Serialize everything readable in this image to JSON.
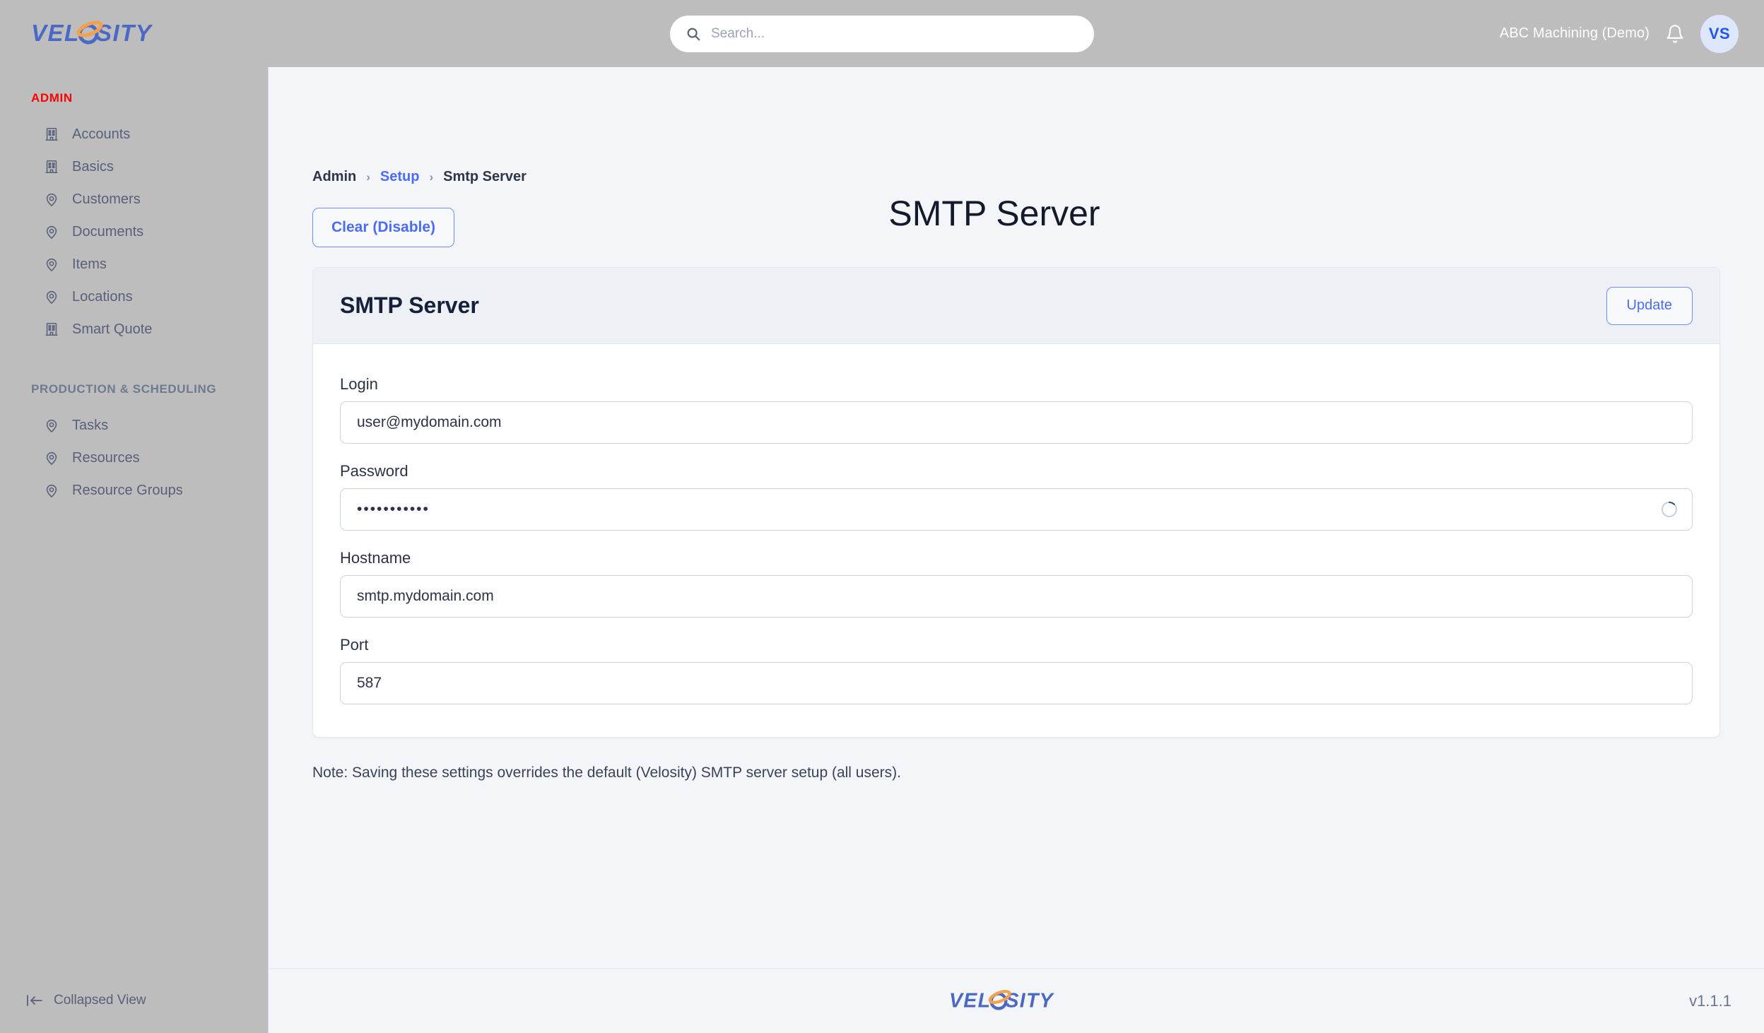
{
  "brand": {
    "name": "VELOSITY",
    "logo_icon": "velosity-logo"
  },
  "topbar": {
    "search": {
      "placeholder": "Search...",
      "value": "",
      "icon": "search-icon"
    },
    "org_name": "ABC Machining (Demo)",
    "notifications_icon": "bell-icon",
    "avatar_initials": "VS"
  },
  "sidebar": {
    "sections": [
      {
        "label": "ADMIN",
        "color": "#ff0000",
        "items": [
          {
            "label": "Accounts",
            "icon": "building-icon"
          },
          {
            "label": "Basics",
            "icon": "building-icon"
          },
          {
            "label": "Customers",
            "icon": "map-pin-icon"
          },
          {
            "label": "Documents",
            "icon": "map-pin-icon"
          },
          {
            "label": "Items",
            "icon": "map-pin-icon"
          },
          {
            "label": "Locations",
            "icon": "map-pin-icon"
          },
          {
            "label": "Smart Quote",
            "icon": "building-icon"
          }
        ]
      },
      {
        "label": "PRODUCTION & SCHEDULING",
        "color": "#707a8f",
        "items": [
          {
            "label": "Tasks",
            "icon": "map-pin-icon"
          },
          {
            "label": "Resources",
            "icon": "map-pin-icon"
          },
          {
            "label": "Resource Groups",
            "icon": "map-pin-icon"
          }
        ]
      }
    ],
    "collapse": {
      "label": "Collapsed View",
      "icon": "collapse-left-icon"
    }
  },
  "breadcrumb": {
    "items": [
      {
        "label": "Admin",
        "link": false
      },
      {
        "label": "Setup",
        "link": true
      },
      {
        "label": "Smtp Server",
        "link": false
      }
    ],
    "separator": "›"
  },
  "page": {
    "title": "SMTP Server",
    "clear_button": "Clear (Disable)",
    "note": "Note: Saving these settings overrides the default (Velosity) SMTP server setup (all users)."
  },
  "card": {
    "title": "SMTP Server",
    "update_button": "Update",
    "fields": [
      {
        "label": "Login",
        "value": "user@mydomain.com",
        "placeholder": "",
        "type": "text",
        "name": "login"
      },
      {
        "label": "Password",
        "value": "•••••••••••",
        "placeholder": "",
        "type": "password",
        "name": "password",
        "trailing_icon": "spinner-icon"
      },
      {
        "label": "Hostname",
        "value": "smtp.mydomain.com",
        "placeholder": "",
        "type": "text",
        "name": "hostname"
      },
      {
        "label": "Port",
        "value": "587",
        "placeholder": "",
        "type": "text",
        "name": "port"
      }
    ]
  },
  "footer": {
    "logo_icon": "velosity-logo",
    "version": "v1.1.1"
  },
  "colors": {
    "accent": "#4a6cf7",
    "sidebar_bg": "#bdbdbd",
    "page_bg": "#f4f5f9",
    "card_head_bg": "#edf0f5",
    "admin_label": "#ff0000",
    "brand_blue": "#4a69c4",
    "brand_orange": "#f5a04c"
  }
}
